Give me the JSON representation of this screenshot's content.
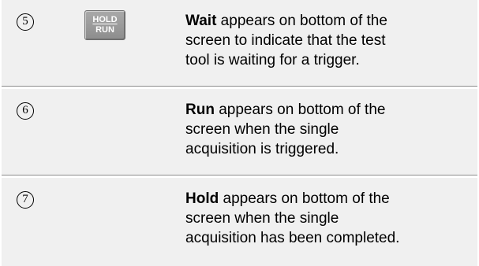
{
  "steps": [
    {
      "number": "5",
      "key": {
        "line1": "HOLD",
        "line2": "RUN"
      },
      "term": "Wait",
      "line1": " appears on bottom of the",
      "line2": "screen to indicate that the test",
      "line3": "tool is waiting for a trigger."
    },
    {
      "number": "6",
      "term": "Run",
      "line1": " appears on bottom of the",
      "line2": "screen when the single",
      "line3": "acquisition is triggered."
    },
    {
      "number": "7",
      "term": "Hold",
      "line1": " appears on bottom of the",
      "line2": "screen when the single",
      "line3": "acquisition has been completed."
    }
  ]
}
